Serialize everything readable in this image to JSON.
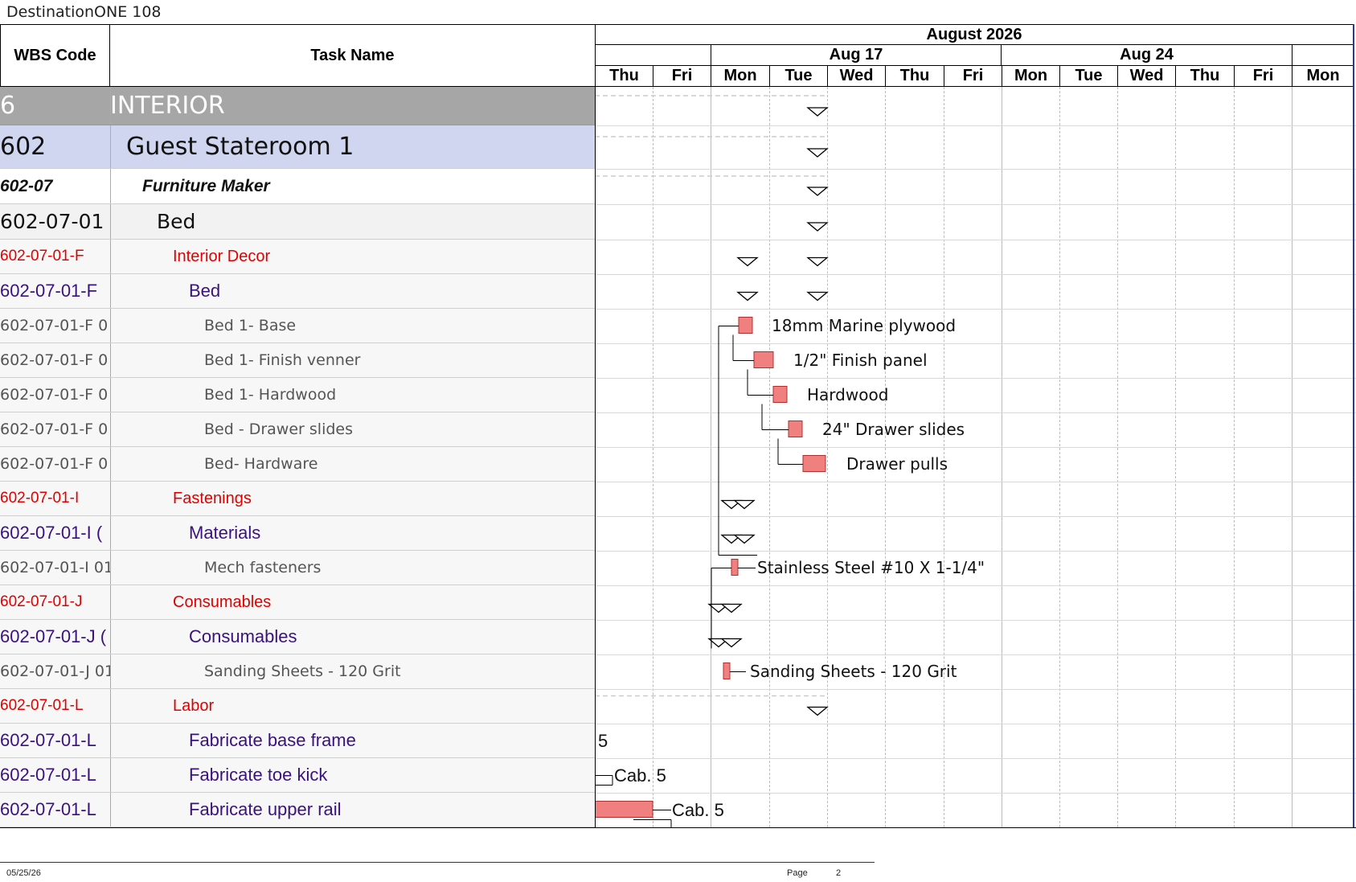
{
  "document_title": "DestinationONE 108",
  "header": {
    "wbs_label": "WBS Code",
    "task_label": "Task Name",
    "month": "August 2026",
    "weeks": [
      "Aug 17",
      "Aug 24"
    ],
    "days": [
      "Thu",
      "Fri",
      "Mon",
      "Tue",
      "Wed",
      "Thu",
      "Fri",
      "Mon",
      "Tue",
      "Wed",
      "Thu",
      "Fri",
      "Mon"
    ]
  },
  "rows": [
    {
      "wbs": "6",
      "task": "INTERIOR",
      "style": "section"
    },
    {
      "wbs": "602",
      "task": "Guest Stateroom 1",
      "style": "group"
    },
    {
      "wbs": "602-07",
      "task": "Furniture Maker",
      "style": "subgroup"
    },
    {
      "wbs": "602-07-01",
      "task": "Bed",
      "style": "item"
    },
    {
      "wbs": "602-07-01-F",
      "task": "Interior Decor",
      "style": "red"
    },
    {
      "wbs": "602-07-01-F",
      "task": "Bed",
      "style": "purple"
    },
    {
      "wbs": "602-07-01-F 0",
      "task": "Bed 1- Base",
      "style": "gray"
    },
    {
      "wbs": "602-07-01-F 0",
      "task": "Bed 1- Finish venner",
      "style": "gray"
    },
    {
      "wbs": "602-07-01-F 0",
      "task": "Bed 1- Hardwood",
      "style": "gray"
    },
    {
      "wbs": "602-07-01-F 0",
      "task": "Bed - Drawer slides",
      "style": "gray"
    },
    {
      "wbs": "602-07-01-F 0",
      "task": "Bed- Hardware",
      "style": "gray"
    },
    {
      "wbs": "602-07-01-I",
      "task": "Fastenings",
      "style": "red"
    },
    {
      "wbs": "602-07-01-I (",
      "task": "Materials",
      "style": "purple"
    },
    {
      "wbs": "602-07-01-I 01",
      "task": "Mech fasteners",
      "style": "gray"
    },
    {
      "wbs": "602-07-01-J",
      "task": "Consumables",
      "style": "red"
    },
    {
      "wbs": "602-07-01-J (",
      "task": "Consumables",
      "style": "purple"
    },
    {
      "wbs": "602-07-01-J 01",
      "task": "Sanding Sheets - 120 Grit",
      "style": "gray"
    },
    {
      "wbs": "602-07-01-L",
      "task": "Labor",
      "style": "red"
    },
    {
      "wbs": "602-07-01-L",
      "task": "Fabricate base frame",
      "style": "purple"
    },
    {
      "wbs": "602-07-01-L",
      "task": "Fabricate toe kick",
      "style": "purple"
    },
    {
      "wbs": "602-07-01-L",
      "task": "Fabricate upper rail",
      "style": "purple"
    }
  ],
  "gantt_labels": {
    "r6": "18mm Marine plywood",
    "r7": "1/2\" Finish panel",
    "r8": "Hardwood",
    "r9": "24\" Drawer slides",
    "r10": "Drawer pulls",
    "r13": "Stainless Steel #10 X 1-1/4\"",
    "r16": "Sanding Sheets - 120 Grit",
    "r18": "5",
    "r19": "Cab. 5",
    "r20": "Cab. 5"
  },
  "colors": {
    "section_bg": "#a6a6a6",
    "group_bg": "#d0d6f0",
    "item_bg": "#f2f2f2",
    "row_bg": "#f7f7f7",
    "red_text": "#e00000",
    "purple_text": "#3a1280",
    "bar_fill": "#f08080"
  },
  "footer": {
    "date": "05/25/26",
    "page_label": "Page",
    "page_number": "2"
  }
}
